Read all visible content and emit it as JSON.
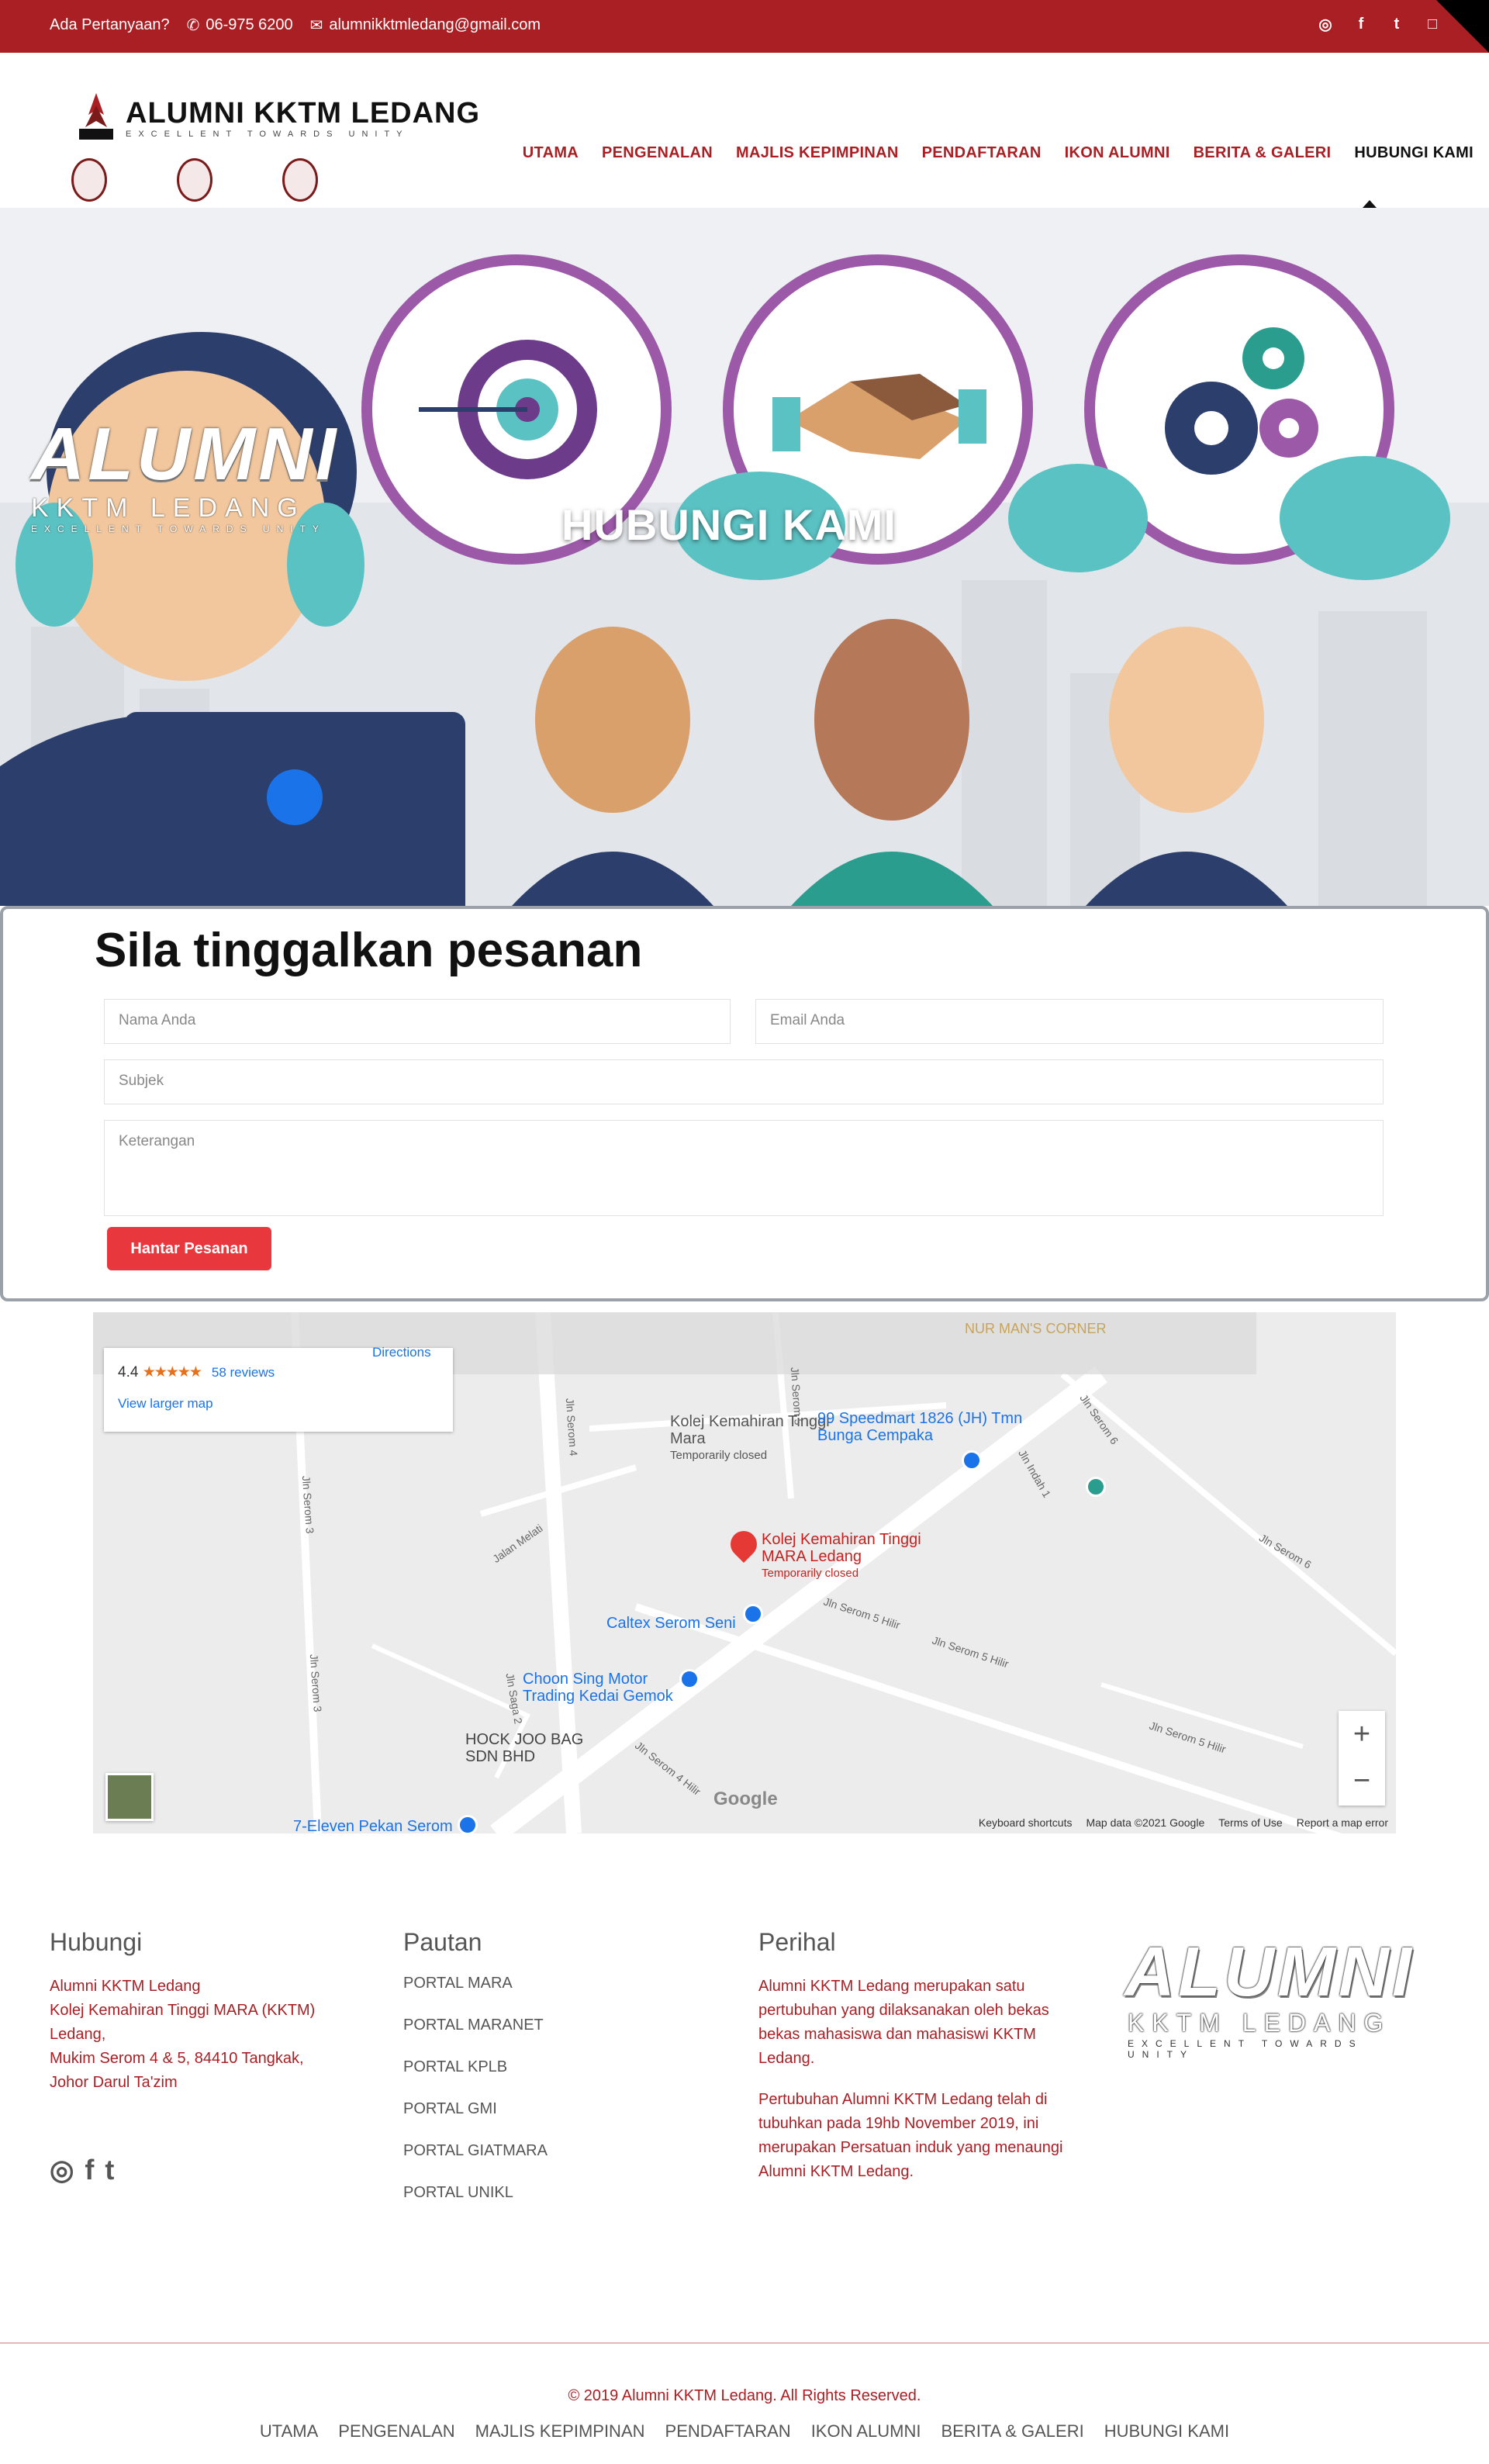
{
  "topbar": {
    "question": "Ada Pertanyaan?",
    "phone": "06-975 6200",
    "email": "alumnikktmledang@gmail.com"
  },
  "brand": {
    "name": "ALUMNI KKTM LEDANG",
    "tagline": "EXCELLENT TOWARDS UNITY"
  },
  "nav": {
    "items": [
      "UTAMA",
      "PENGENALAN",
      "MAJLIS KEPIMPINAN",
      "PENDAFTARAN",
      "IKON ALUMNI",
      "BERITA & GALERI",
      "HUBUNGI KAMI"
    ],
    "active": "HUBUNGI KAMI"
  },
  "hero": {
    "title": "HUBUNGI KAMI",
    "overlay_big": "ALUMNI",
    "overlay_mid": "KKTM LEDANG",
    "overlay_small": "EXCELLENT TOWARDS UNITY"
  },
  "form": {
    "heading": "Sila tinggalkan pesanan",
    "name_placeholder": "Nama Anda",
    "email_placeholder": "Email Anda",
    "subject_placeholder": "Subjek",
    "message_placeholder": "Keterangan",
    "submit_label": "Hantar Pesanan"
  },
  "map": {
    "rating": "4.4",
    "stars": "★★★★★",
    "reviews": "58 reviews",
    "directions": "Directions",
    "larger_map": "View larger map",
    "top_label": "NUR MAN'S CORNER",
    "places": {
      "kolej_grey": "Kolej Kemahiran Tinggi Mara",
      "kolej_grey_status": "Temporarily closed",
      "speedmart": "99 Speedmart 1826 (JH) Tmn Bunga Cempaka",
      "kolej_main": "Kolej Kemahiran Tinggi MARA Ledang",
      "kolej_main_status": "Temporarily closed",
      "caltex": "Caltex Serom Seni",
      "choon": "Choon Sing Motor Trading Kedai Gemok",
      "hock": "HOCK JOO BAG SDN BHD",
      "seven": "7-Eleven Pekan Serom"
    },
    "streets": [
      "Jln Serom 4",
      "Jln Serom 5",
      "Jalan Melati",
      "Jln Serom 3",
      "Jln Indah 1",
      "Jln Serom 6",
      "Jln Serom 5 Hilir",
      "Jln Serom 5 Hilir",
      "Jln Serom 5 Hilir",
      "Jln Serom 4 Hilir",
      "Jln Serom 6",
      "Jln Saga 2",
      "Jln Serom 3"
    ],
    "zoom_in": "+",
    "zoom_out": "−",
    "google": "Google",
    "footer_links": [
      "Keyboard shortcuts",
      "Map data ©2021 Google",
      "Terms of Use",
      "Report a map error"
    ]
  },
  "footer": {
    "hubungi_title": "Hubungi",
    "address": [
      "Alumni KKTM Ledang",
      "Kolej Kemahiran Tinggi MARA (KKTM) Ledang,",
      "Mukim Serom 4 & 5, 84410 Tangkak,",
      "Johor Darul Ta'zim"
    ],
    "pautan_title": "Pautan",
    "links": [
      "PORTAL MARA",
      "PORTAL MARANET",
      "PORTAL KPLB",
      "PORTAL GMI",
      "PORTAL GIATMARA",
      "PORTAL UNIKL"
    ],
    "perihal_title": "Perihal",
    "perihal_p1": "Alumni KKTM Ledang merupakan satu pertubuhan yang dilaksanakan oleh bekas bekas mahasiswa dan mahasiswi KKTM Ledang.",
    "perihal_p2": "Pertubuhan Alumni KKTM Ledang telah di tubuhkan pada 19hb November 2019, ini merupakan Persatuan induk yang menaungi Alumni KKTM Ledang.",
    "logo_big": "ALUMNI",
    "logo_mid": "KKTM LEDANG",
    "logo_small": "EXCELLENT TOWARDS UNITY",
    "copyright": "© 2019 Alumni KKTM Ledang. All Rights Reserved.",
    "nav": [
      "UTAMA",
      "PENGENALAN",
      "MAJLIS KEPIMPINAN",
      "PENDAFTARAN",
      "IKON ALUMNI",
      "BERITA & GALERI",
      "HUBUNGI KAMI"
    ]
  },
  "colors": {
    "brand": "#a91f24",
    "button": "#e8383d",
    "purple": "#9b59a8"
  }
}
